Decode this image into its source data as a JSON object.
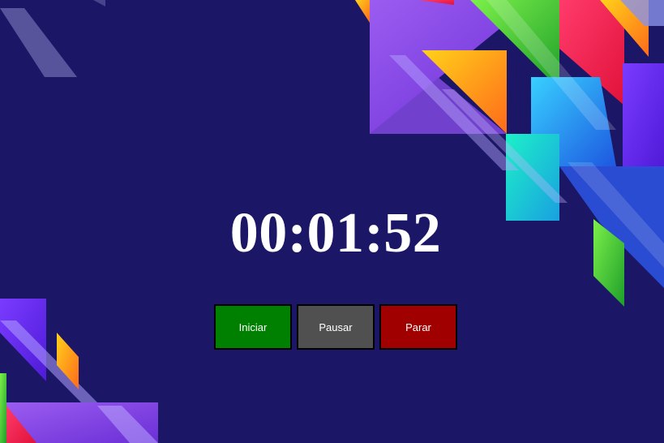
{
  "timer": {
    "display": "00:01:52"
  },
  "controls": {
    "start": {
      "label": "Iniciar",
      "color": "#008000"
    },
    "pause": {
      "label": "Pausar",
      "color": "#505050"
    },
    "stop": {
      "label": "Parar",
      "color": "#a00000"
    }
  },
  "theme": {
    "background": "#1b1766",
    "text": "#ffffff"
  }
}
